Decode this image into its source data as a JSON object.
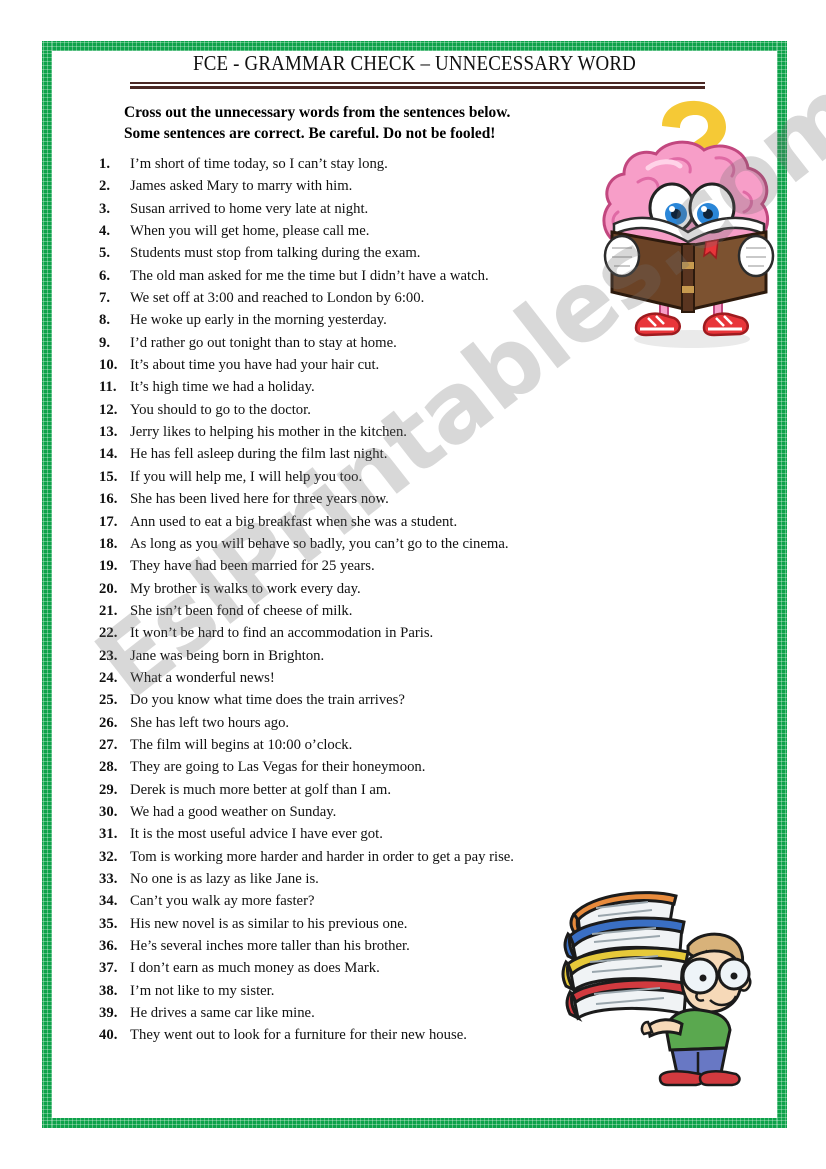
{
  "worksheet": {
    "title": "FCE - GRAMMAR CHECK – UNNECESSARY WORD",
    "instruction_line_1": "Cross out the unnecessary words from the sentences below.",
    "instruction_line_2": "Some sentences are correct. Be careful. Do not be fooled!",
    "watermark": "EslPrintables.com"
  },
  "colors": {
    "border_green": "#0da24a",
    "rule_maroon": "#4a2824",
    "question_mark_yellow": "#f5c936",
    "brain_pink": "#f79ec8",
    "book_brown": "#6b4326",
    "watermark_gray": "#6e6e6e"
  },
  "items": [
    {
      "n": "1.",
      "text": "I’m short of time today, so I can’t stay long."
    },
    {
      "n": "2.",
      "text": "James asked Mary to marry with him."
    },
    {
      "n": "3.",
      "text": "Susan arrived to home very late at night."
    },
    {
      "n": "4.",
      "text": "When you will get home, please call me."
    },
    {
      "n": "5.",
      "text": "Students must stop from talking during the exam."
    },
    {
      "n": "6.",
      "text": "The old man asked for me the time but I didn’t have a watch."
    },
    {
      "n": "7.",
      "text": "We set off at 3:00 and reached to London by 6:00."
    },
    {
      "n": "8.",
      "text": "He woke up early in the morning yesterday."
    },
    {
      "n": "9.",
      "text": "I’d rather go out tonight than to stay at home."
    },
    {
      "n": "10.",
      "text": "It’s about time you have had your hair cut."
    },
    {
      "n": "11.",
      "text": "It’s high time we had a holiday."
    },
    {
      "n": "12.",
      "text": "You should to go to the doctor."
    },
    {
      "n": "13.",
      "text": "Jerry likes to helping his mother in the kitchen."
    },
    {
      "n": "14.",
      "text": "He has fell asleep during the film last night."
    },
    {
      "n": "15.",
      "text": "If you will help me, I will help you too."
    },
    {
      "n": "16.",
      "text": "She has been lived here for three years now."
    },
    {
      "n": "17.",
      "text": "Ann used to eat a big breakfast when she was a student."
    },
    {
      "n": "18.",
      "text": "As long as you will behave so badly, you can’t go to the cinema."
    },
    {
      "n": "19.",
      "text": "They have had been married for 25 years."
    },
    {
      "n": "20.",
      "text": "My brother is walks to work every day."
    },
    {
      "n": "21.",
      "text": "She isn’t been fond of cheese of milk."
    },
    {
      "n": "22.",
      "text": "It won’t be hard to find an accommodation in Paris."
    },
    {
      "n": "23.",
      "text": "Jane was being born in Brighton."
    },
    {
      "n": "24.",
      "text": "What a wonderful news!"
    },
    {
      "n": "25.",
      "text": "Do you know what time does the train arrives?"
    },
    {
      "n": "26.",
      "text": "She has left two hours ago."
    },
    {
      "n": "27.",
      "text": "The film will begins at 10:00 o’clock."
    },
    {
      "n": "28.",
      "text": "They are going to Las Vegas for their honeymoon."
    },
    {
      "n": "29.",
      "text": "Derek is much more better at golf than I am."
    },
    {
      "n": "30.",
      "text": "We had a good weather on Sunday."
    },
    {
      "n": "31.",
      "text": "It is the most useful advice I have ever got."
    },
    {
      "n": "32.",
      "text": "Tom is working more harder and harder in order to get a pay rise."
    },
    {
      "n": "33.",
      "text": "No one is as lazy as like Jane is."
    },
    {
      "n": "34.",
      "text": "Can’t you walk ay more faster?"
    },
    {
      "n": "35.",
      "text": "His new novel is as similar to his previous one."
    },
    {
      "n": "36.",
      "text": "He’s several inches more taller than his brother."
    },
    {
      "n": "37.",
      "text": "I don’t earn as much money as does Mark."
    },
    {
      "n": "38.",
      "text": "I’m not like to my sister."
    },
    {
      "n": "39.",
      "text": "He drives a same car like mine."
    },
    {
      "n": "40.",
      "text": "They went out to look for a furniture for their new house."
    }
  ],
  "illustrations": {
    "brain": {
      "name": "brain-reading-book-illustration",
      "description": "Pink cartoon brain character with big eyes reading an open brown book, wearing white gloves and red sneakers, with a yellow question mark above"
    },
    "books": {
      "name": "boy-carrying-books-illustration",
      "description": "Cartoon boy with glasses and green shirt carrying a tall stack of four books (orange, blue, yellow, red)"
    }
  }
}
